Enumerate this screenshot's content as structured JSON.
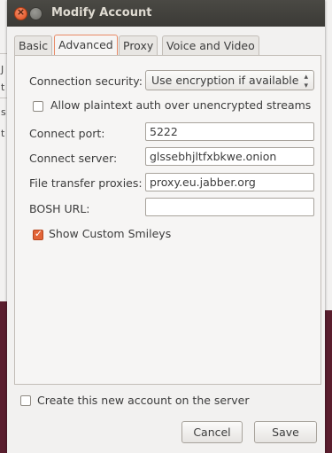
{
  "window": {
    "title": "Modify Account"
  },
  "background": {
    "fragments": [
      "J",
      "t",
      "s",
      "t"
    ]
  },
  "tabs": [
    {
      "label": "Basic",
      "active": false
    },
    {
      "label": "Advanced",
      "active": true
    },
    {
      "label": "Proxy",
      "active": false
    },
    {
      "label": "Voice and Video",
      "active": false
    }
  ],
  "advanced": {
    "connection_security_label": "Connection security:",
    "connection_security_value": "Use encryption if available",
    "allow_plaintext_label": "Allow plaintext auth over unencrypted streams",
    "allow_plaintext_checked": false,
    "connect_port_label": "Connect port:",
    "connect_port_value": "5222",
    "connect_server_label": "Connect server:",
    "connect_server_value": "glssebhjltfxbkwe.onion",
    "file_transfer_label": "File transfer proxies:",
    "file_transfer_value": "proxy.eu.jabber.org",
    "bosh_label": "BOSH URL:",
    "bosh_value": "",
    "smileys_label": "Show Custom Smileys",
    "smileys_checked": true
  },
  "footer": {
    "create_account_label": "Create this new account on the server",
    "create_account_checked": false,
    "cancel_label": "Cancel",
    "save_label": "Save"
  },
  "colors": {
    "accent": "#e26437",
    "titlebar": "#3c3b37",
    "dialog_bg": "#f2f1f0"
  }
}
